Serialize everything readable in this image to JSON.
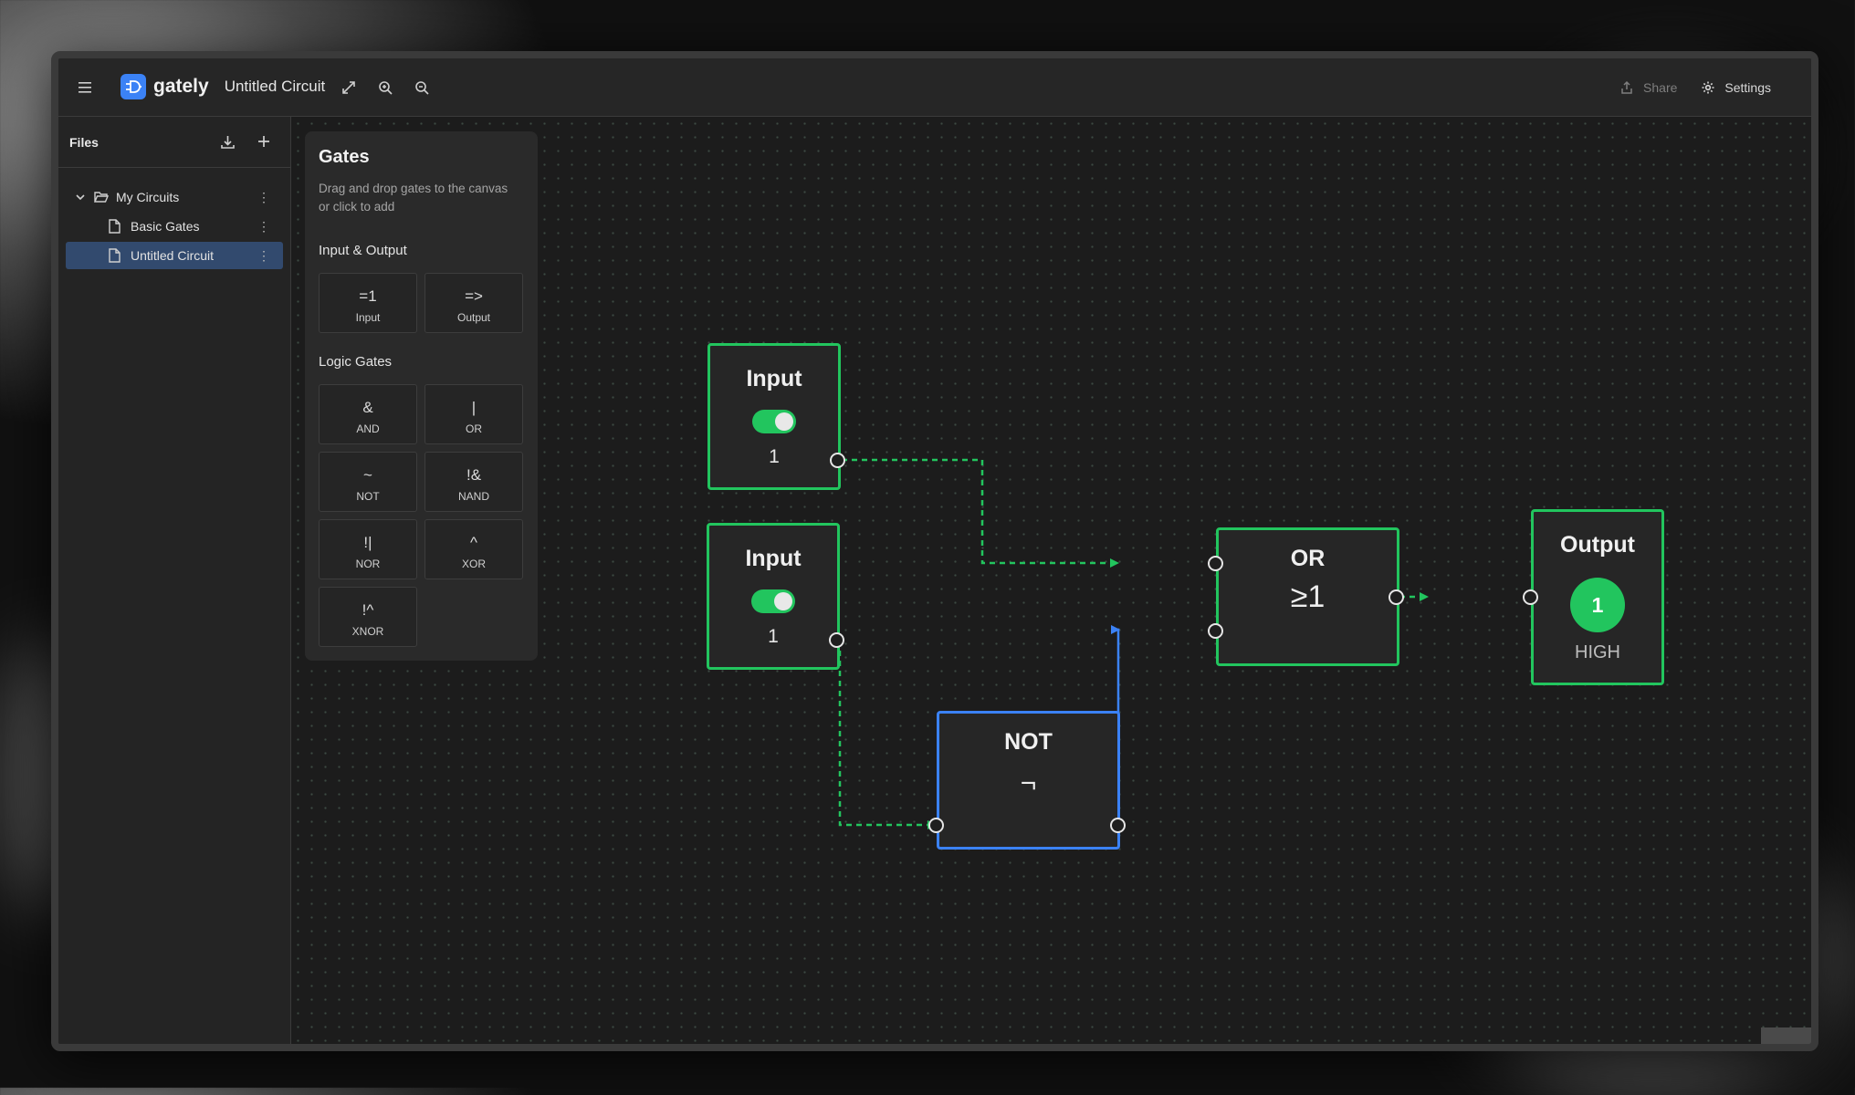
{
  "app": {
    "name": "gately",
    "document_title": "Untitled Circuit",
    "share_label": "Share",
    "settings_label": "Settings"
  },
  "sidebar": {
    "title": "Files",
    "tree": [
      {
        "label": "My Circuits",
        "type": "folder",
        "expanded": true
      },
      {
        "label": "Basic Gates",
        "type": "file"
      },
      {
        "label": "Untitled Circuit",
        "type": "file",
        "active": true
      }
    ]
  },
  "palette": {
    "title": "Gates",
    "description": "Drag and drop gates to the canvas or click to add",
    "sections": [
      {
        "title": "Input & Output",
        "tiles": [
          {
            "symbol": "=1",
            "label": "Input"
          },
          {
            "symbol": "=>",
            "label": "Output"
          }
        ]
      },
      {
        "title": "Logic Gates",
        "tiles": [
          {
            "symbol": "&",
            "label": "AND"
          },
          {
            "symbol": "|",
            "label": "OR"
          },
          {
            "symbol": "~",
            "label": "NOT"
          },
          {
            "symbol": "!&",
            "label": "NAND"
          },
          {
            "symbol": "!|",
            "label": "NOR"
          },
          {
            "symbol": "^",
            "label": "XOR"
          },
          {
            "symbol": "!^",
            "label": "XNOR"
          }
        ]
      }
    ]
  },
  "circuit": {
    "nodes": [
      {
        "id": "input1",
        "title": "Input",
        "value": "1",
        "on": true
      },
      {
        "id": "input2",
        "title": "Input",
        "value": "1",
        "on": true
      },
      {
        "id": "not1",
        "title": "NOT",
        "symbol": "¬"
      },
      {
        "id": "or1",
        "title": "OR",
        "symbol": "≥1"
      },
      {
        "id": "output1",
        "title": "Output",
        "value": "1",
        "state": "HIGH"
      }
    ]
  },
  "colors": {
    "accent": "#3b82f6",
    "active_green": "#22c55e",
    "selection": "#324a6e"
  }
}
